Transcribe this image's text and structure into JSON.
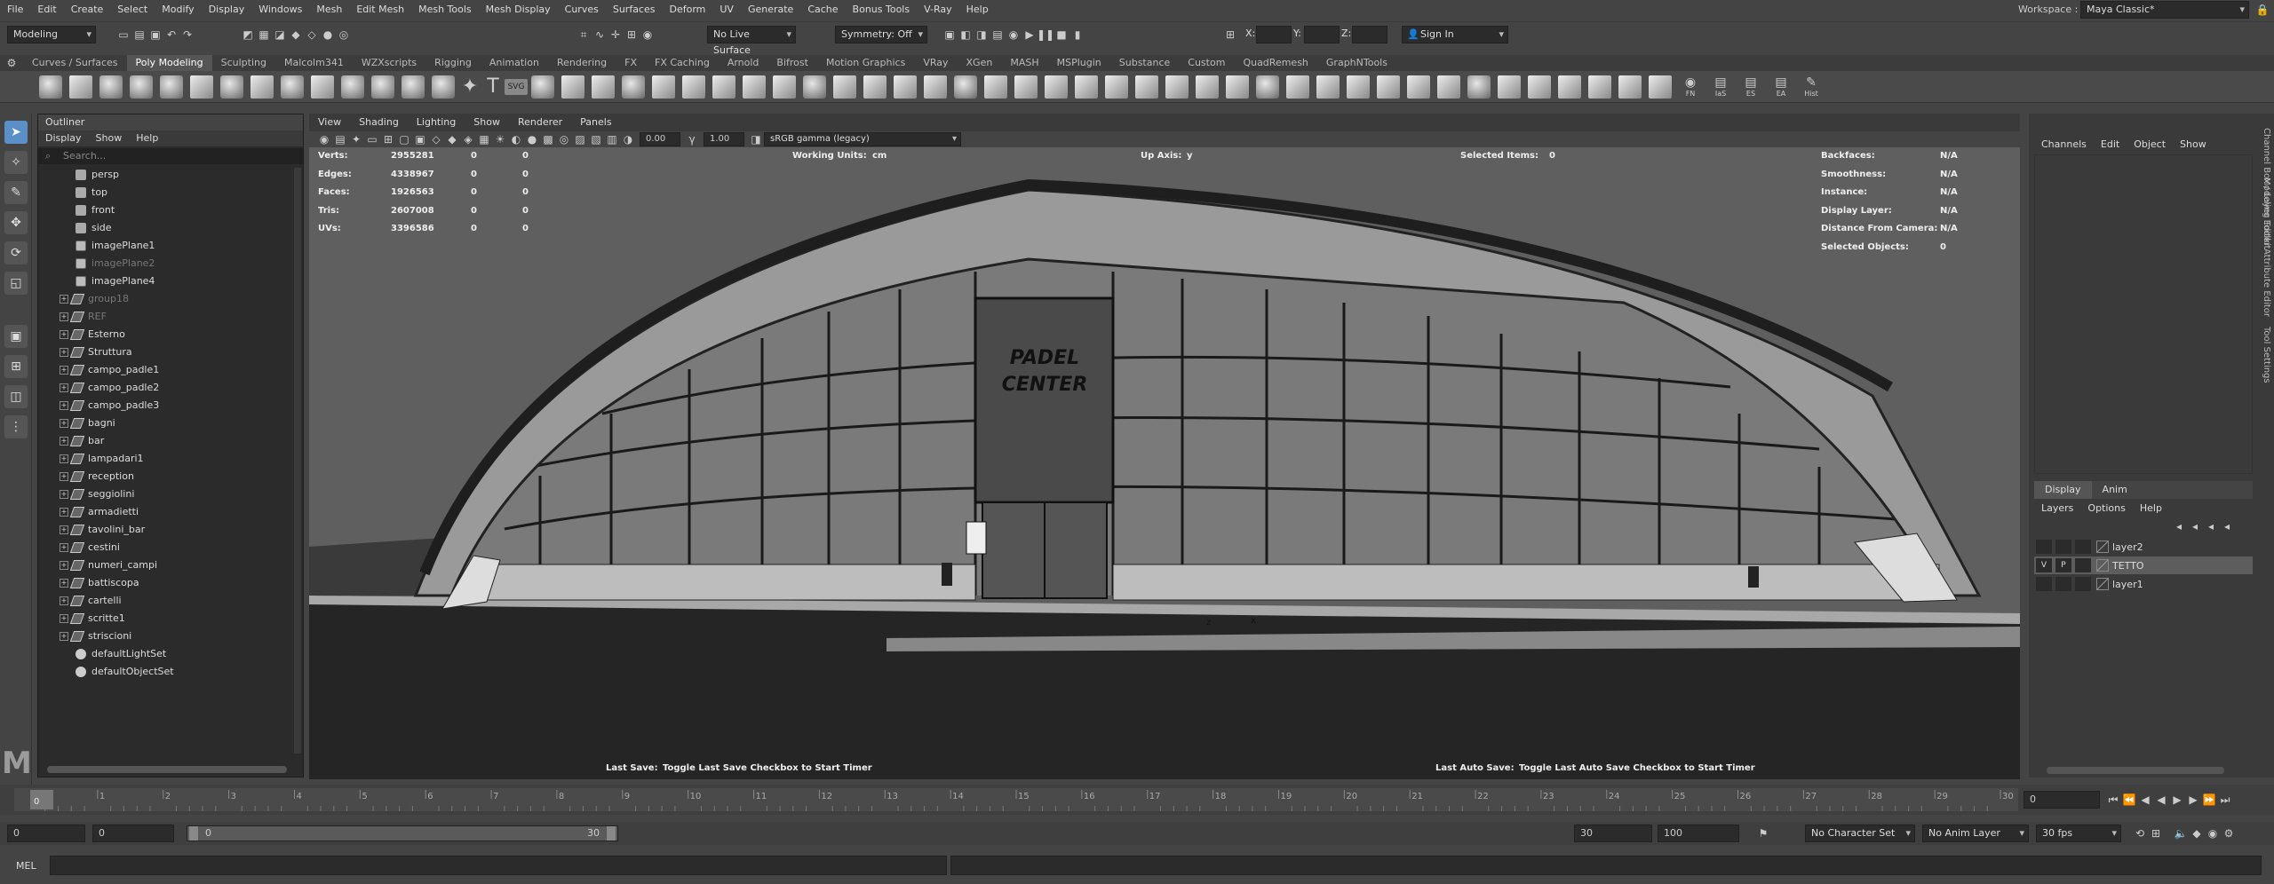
{
  "menubar": {
    "items": [
      "File",
      "Edit",
      "Create",
      "Select",
      "Modify",
      "Display",
      "Windows",
      "Mesh",
      "Edit Mesh",
      "Mesh Tools",
      "Mesh Display",
      "Curves",
      "Surfaces",
      "Deform",
      "UV",
      "Generate",
      "Cache",
      "Bonus Tools",
      "V-Ray",
      "Help"
    ],
    "workspace_label": "Workspace :",
    "workspace_value": "Maya Classic*"
  },
  "statusline": {
    "mode": "Modeling",
    "live_surface": "No Live Surface",
    "symmetry": "Symmetry: Off",
    "x_label": "X:",
    "y_label": "Y:",
    "z_label": "Z:",
    "sign_in": "Sign In"
  },
  "shelf_tabs": [
    "Curves / Surfaces",
    "Poly Modeling",
    "Sculpting",
    "Malcolm341",
    "WZXscripts",
    "Rigging",
    "Animation",
    "Rendering",
    "FX",
    "FX Caching",
    "Arnold",
    "Bifrost",
    "Motion Graphics",
    "VRay",
    "XGen",
    "MASH",
    "MSPlugin",
    "Substance",
    "Custom",
    "QuadRemesh",
    "GraphNTools"
  ],
  "shelf_text_icons": {
    "svg": "SVG",
    "fn": "FN",
    "ias": "IaS",
    "es": "ES",
    "ea": "EA",
    "hist": "Hist"
  },
  "outliner": {
    "title": "Outliner",
    "menu": [
      "Display",
      "Show",
      "Help"
    ],
    "search_placeholder": "Search...",
    "items": [
      {
        "label": "persp",
        "type": "camera",
        "dim": false
      },
      {
        "label": "top",
        "type": "camera",
        "dim": false
      },
      {
        "label": "front",
        "type": "camera",
        "dim": false
      },
      {
        "label": "side",
        "type": "camera",
        "dim": false
      },
      {
        "label": "imagePlane1",
        "type": "plane",
        "dim": false
      },
      {
        "label": "imagePlane2",
        "type": "plane",
        "dim": true
      },
      {
        "label": "imagePlane4",
        "type": "plane",
        "dim": false
      },
      {
        "label": "group18",
        "type": "group",
        "dim": true
      },
      {
        "label": "REF",
        "type": "group",
        "dim": true
      },
      {
        "label": "Esterno",
        "type": "group",
        "dim": false
      },
      {
        "label": "Struttura",
        "type": "group",
        "dim": false
      },
      {
        "label": "campo_padle1",
        "type": "group",
        "dim": false
      },
      {
        "label": "campo_padle2",
        "type": "group",
        "dim": false
      },
      {
        "label": "campo_padle3",
        "type": "group",
        "dim": false
      },
      {
        "label": "bagni",
        "type": "group",
        "dim": false
      },
      {
        "label": "bar",
        "type": "group",
        "dim": false
      },
      {
        "label": "lampadari1",
        "type": "group",
        "dim": false
      },
      {
        "label": "reception",
        "type": "group",
        "dim": false
      },
      {
        "label": "seggiolini",
        "type": "group",
        "dim": false
      },
      {
        "label": "armadietti",
        "type": "group",
        "dim": false
      },
      {
        "label": "tavolini_bar",
        "type": "group",
        "dim": false
      },
      {
        "label": "cestini",
        "type": "group",
        "dim": false
      },
      {
        "label": "numeri_campi",
        "type": "group",
        "dim": false
      },
      {
        "label": "battiscopa",
        "type": "group",
        "dim": false
      },
      {
        "label": "cartelli",
        "type": "group",
        "dim": false
      },
      {
        "label": "scritte1",
        "type": "group",
        "dim": false
      },
      {
        "label": "striscioni",
        "type": "group",
        "dim": false
      },
      {
        "label": "defaultLightSet",
        "type": "set",
        "dim": false
      },
      {
        "label": "defaultObjectSet",
        "type": "set",
        "dim": false
      }
    ]
  },
  "viewport": {
    "menu": [
      "View",
      "Shading",
      "Lighting",
      "Show",
      "Renderer",
      "Panels"
    ],
    "exposure": "0.00",
    "gamma": "1.00",
    "colorspace": "sRGB gamma (legacy)",
    "stats": [
      {
        "label": "Verts:",
        "v1": "2955281",
        "v2": "0",
        "v3": "0"
      },
      {
        "label": "Edges:",
        "v1": "4338967",
        "v2": "0",
        "v3": "0"
      },
      {
        "label": "Faces:",
        "v1": "1926563",
        "v2": "0",
        "v3": "0"
      },
      {
        "label": "Tris:",
        "v1": "2607008",
        "v2": "0",
        "v3": "0"
      },
      {
        "label": "UVs:",
        "v1": "3396586",
        "v2": "0",
        "v3": "0"
      }
    ],
    "working_units_label": "Working Units:",
    "working_units": "cm",
    "up_axis_label": "Up Axis:",
    "up_axis": "y",
    "selected_items_label": "Selected Items:",
    "selected_items": "0",
    "right_stats": [
      {
        "label": "Backfaces:",
        "value": "N/A"
      },
      {
        "label": "Smoothness:",
        "value": "N/A"
      },
      {
        "label": "Instance:",
        "value": "N/A"
      },
      {
        "label": "Display Layer:",
        "value": "N/A"
      },
      {
        "label": "Distance From Camera:",
        "value": "N/A"
      },
      {
        "label": "Selected Objects:",
        "value": "0"
      }
    ],
    "last_save_label": "Last Save:",
    "last_save": "Toggle Last Save Checkbox to Start Timer",
    "last_auto_save_label": "Last Auto Save:",
    "last_auto_save": "Toggle Last Auto Save Checkbox to Start Timer",
    "sign_line1": "PADEL",
    "sign_line2": "CENTER",
    "axis_z": "z",
    "axis_x": "x"
  },
  "channel_box": {
    "menu": [
      "Channels",
      "Edit",
      "Object",
      "Show"
    ]
  },
  "side_tabs": [
    "Channel Box / Layer Editor",
    "Modeling Toolkit",
    "Attribute Editor",
    "Tool Settings"
  ],
  "layer_editor": {
    "tabs": [
      "Display",
      "Anim"
    ],
    "menu": [
      "Layers",
      "Options",
      "Help"
    ],
    "layers": [
      {
        "name": "layer2",
        "v": "",
        "p": "",
        "selected": false
      },
      {
        "name": "TETTO",
        "v": "V",
        "p": "P",
        "selected": true
      },
      {
        "name": "layer1",
        "v": "",
        "p": "",
        "selected": false
      }
    ]
  },
  "timeline": {
    "ticks": [
      "1",
      "2",
      "3",
      "4",
      "5",
      "6",
      "7",
      "8",
      "9",
      "10",
      "11",
      "12",
      "13",
      "14",
      "15",
      "16",
      "17",
      "18",
      "19",
      "20",
      "21",
      "22",
      "23",
      "24",
      "25",
      "26",
      "27",
      "28",
      "29",
      "30"
    ],
    "current_frame": "0",
    "current_frame_field": "0"
  },
  "range": {
    "start": "0",
    "start2": "0",
    "slider_start": "0",
    "slider_end": "30",
    "end": "30",
    "end2": "100",
    "character_set": "No Character Set",
    "anim_layer": "No Anim Layer",
    "fps": "30 fps"
  },
  "cmdline": {
    "label": "MEL"
  }
}
